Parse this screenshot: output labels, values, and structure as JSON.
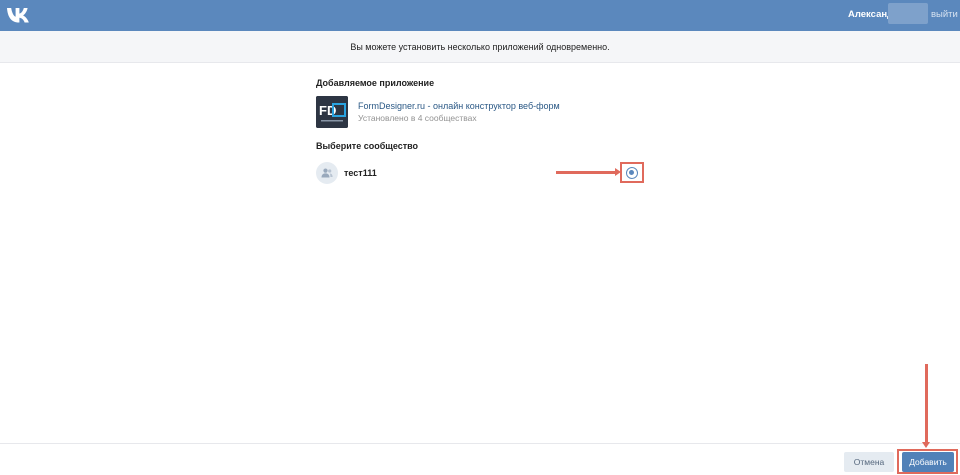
{
  "header": {
    "user_name": "Александр",
    "logout_label": "выйти"
  },
  "notice": {
    "text": "Вы можете установить несколько приложений одновременно."
  },
  "app_section": {
    "title": "Добавляемое приложение",
    "app_name": "FormDesigner.ru - онлайн конструктор веб-форм",
    "installed_text": "Установлено в 4 сообществах",
    "icon_letters": "FD"
  },
  "community_section": {
    "title": "Выберите сообщество",
    "communities": [
      {
        "name": "тест111",
        "selected": true
      }
    ]
  },
  "footer": {
    "cancel_label": "Отмена",
    "add_label": "Добавить"
  },
  "colors": {
    "header_bg": "#5b88bd",
    "link": "#2a5885",
    "primary_button": "#5181b8",
    "annotation": "#e06a5c"
  }
}
